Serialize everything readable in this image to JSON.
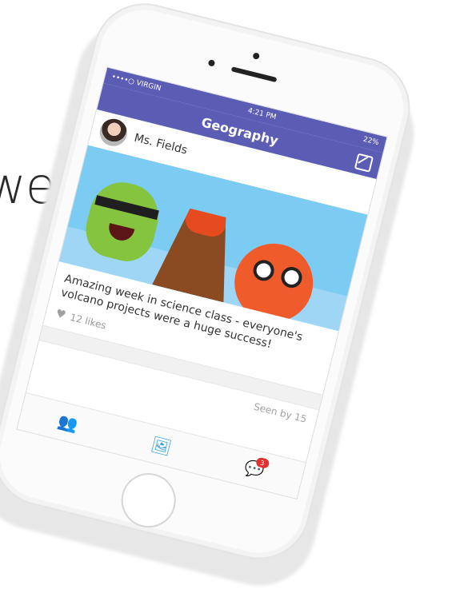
{
  "background": {
    "partial_text": "well!"
  },
  "status": {
    "carrier": "••••○ VIRGIN",
    "time": "4:21 PM",
    "battery": "22%"
  },
  "navbar": {
    "title": "Geography"
  },
  "post": {
    "author": "Ms. Fields",
    "caption": "Amazing week in science class - everyone's volcano projects were a huge success!",
    "likes": "12 likes",
    "seen": "Seen by 15"
  },
  "tabbar": {
    "messages_badge": "3"
  },
  "colors": {
    "header": "#5b5cb4",
    "active_tab": "#3aa3e3",
    "badge": "#e23131"
  },
  "icons": [
    "compose-icon",
    "heart-icon",
    "people-icon",
    "photo-icon",
    "chat-icon"
  ]
}
